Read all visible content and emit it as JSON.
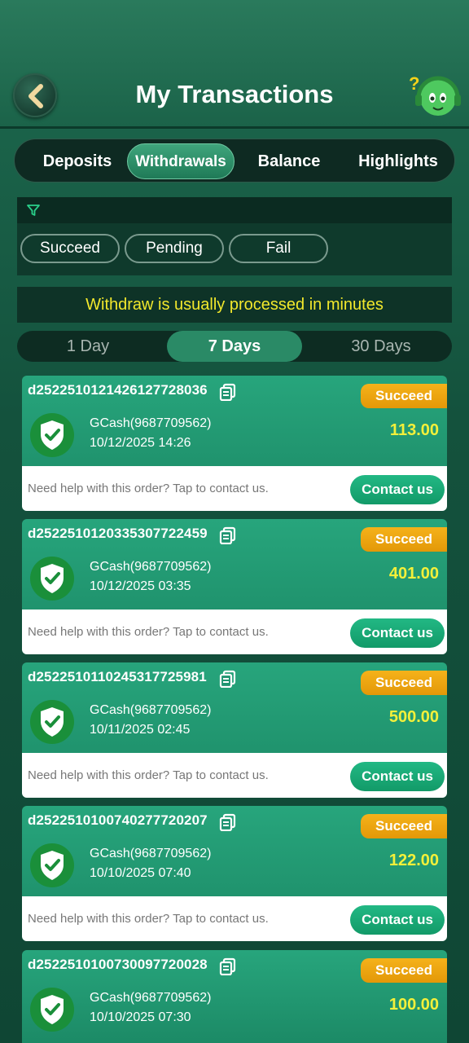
{
  "header": {
    "title": "My Transactions",
    "back_icon": "back-arrow-icon",
    "support_icon": "support-mascot-icon"
  },
  "tabs": [
    {
      "label": "Deposits",
      "active": false
    },
    {
      "label": "Withdrawals",
      "active": true
    },
    {
      "label": "Balance",
      "active": false
    },
    {
      "label": "Highlights",
      "active": false
    }
  ],
  "filter": {
    "icon": "filter-icon",
    "chips": [
      "Succeed",
      "Pending",
      "Fail"
    ]
  },
  "notice": "Withdraw is usually processed in minutes",
  "ranges": [
    {
      "label": "1 Day",
      "active": false
    },
    {
      "label": "7 Days",
      "active": true
    },
    {
      "label": "30 Days",
      "active": false
    }
  ],
  "colors": {
    "accent": "#27a57c",
    "status": "#f0a813",
    "amount": "#f4f03a",
    "notice": "#f2e82c"
  },
  "transactions": [
    {
      "id": "d25225101214261277280​36",
      "status": "Succeed",
      "method": "GCash(9687709562)",
      "datetime": "10/12/2025 14:26",
      "amount": "113.00",
      "help": "Need help with this order? Tap to contact us.",
      "contact": "Contact us"
    },
    {
      "id": "d252251012033530772245​9",
      "status": "Succeed",
      "method": "GCash(9687709562)",
      "datetime": "10/12/2025 03:35",
      "amount": "401.00",
      "help": "Need help with this order? Tap to contact us.",
      "contact": "Contact us"
    },
    {
      "id": "d252251011024531772598​1",
      "status": "Succeed",
      "method": "GCash(9687709562)",
      "datetime": "10/11/2025 02:45",
      "amount": "500.00",
      "help": "Need help with this order? Tap to contact us.",
      "contact": "Contact us"
    },
    {
      "id": "d252251010074027772020​7",
      "status": "Succeed",
      "method": "GCash(9687709562)",
      "datetime": "10/10/2025 07:40",
      "amount": "122.00",
      "help": "Need help with this order? Tap to contact us.",
      "contact": "Contact us"
    },
    {
      "id": "d252251010073009772002​8",
      "status": "Succeed",
      "method": "GCash(9687709562)",
      "datetime": "10/10/2025 07:30",
      "amount": "100.00"
    }
  ]
}
